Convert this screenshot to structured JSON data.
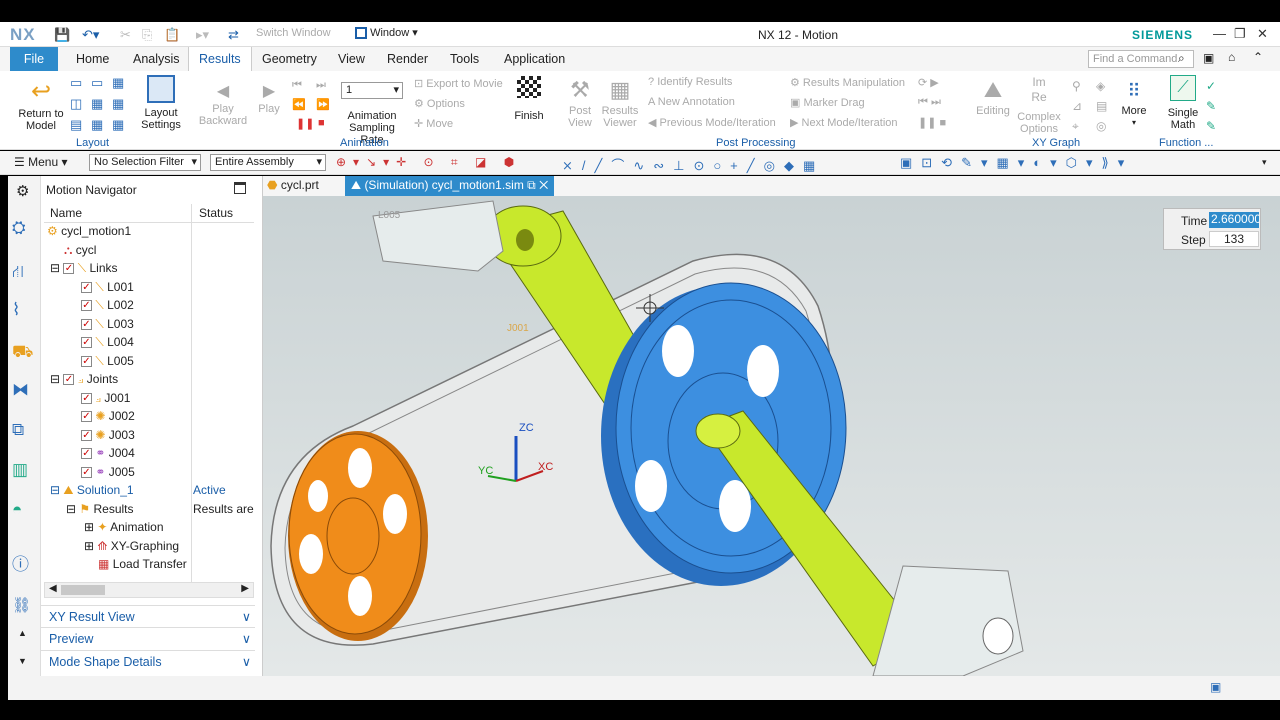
{
  "window": {
    "logo": "NX",
    "title": "NX 12 - Motion",
    "brand": "SIEMENS",
    "switch_window": "Switch Window",
    "window_menu": "Window",
    "find_placeholder": "Find a Command"
  },
  "menu": {
    "file": "File",
    "tabs": [
      "Home",
      "Analysis",
      "Results",
      "Geometry",
      "View",
      "Render",
      "Tools",
      "Application"
    ]
  },
  "ribbon": {
    "return_to_model": "Return to Model",
    "layout_settings": "Layout Settings",
    "play_backward": "Play Backward",
    "play": "Play",
    "sampling_value": "1",
    "animation_sampling_rate": "Animation Sampling Rate",
    "export_to_movie": "Export to Movie",
    "options": "Options",
    "move": "Move",
    "finish": "Finish",
    "post_view": "Post View",
    "results_viewer": "Results Viewer",
    "identify_results": "Identify Results",
    "new_annotation": "New Annotation",
    "prev_mode": "Previous Mode/Iteration",
    "results_manipulation": "Results Manipulation",
    "marker_drag": "Marker Drag",
    "next_mode": "Next Mode/Iteration",
    "editing": "Editing",
    "complex_options": "Complex Options",
    "more": "More",
    "single_math": "Single Math",
    "groups": {
      "layout": "Layout",
      "animation": "Animation",
      "post_processing": "Post Processing",
      "xy_graph": "XY Graph",
      "function": "Function ..."
    }
  },
  "toolbar": {
    "menu": "Menu",
    "selection_filter": "No Selection Filter",
    "assembly": "Entire Assembly"
  },
  "navigator": {
    "title": "Motion Navigator",
    "col_name": "Name",
    "col_status": "Status",
    "root": "cycl_motion1",
    "cycl": "cycl",
    "links": "Links",
    "link_items": [
      "L001",
      "L002",
      "L003",
      "L004",
      "L005"
    ],
    "joints": "Joints",
    "joint_items": [
      "J001",
      "J002",
      "J003",
      "J004",
      "J005"
    ],
    "solution": "Solution_1",
    "solution_status": "Active",
    "results": "Results",
    "results_status": "Results are",
    "animation": "Animation",
    "xy_graphing": "XY-Graphing",
    "load_transfer": "Load Transfer",
    "panels": [
      "XY Result View",
      "Preview",
      "Mode Shape Details"
    ]
  },
  "doctabs": [
    "cycl.prt",
    "(Simulation) cycl_motion1.sim"
  ],
  "viewport": {
    "time_label": "Time",
    "time_value": "2.660000",
    "step_label": "Step",
    "step_value": "133",
    "axis_zc": "ZC",
    "axis_yc": "YC",
    "axis_xc": "XC",
    "label_l005": "L005",
    "label_j001": "J001"
  },
  "colors": {
    "accent": "#2e8bcb",
    "link_green": "#c8e82c",
    "pulley_blue": "#3d8fe0",
    "pulley_orange": "#f08c1a"
  }
}
